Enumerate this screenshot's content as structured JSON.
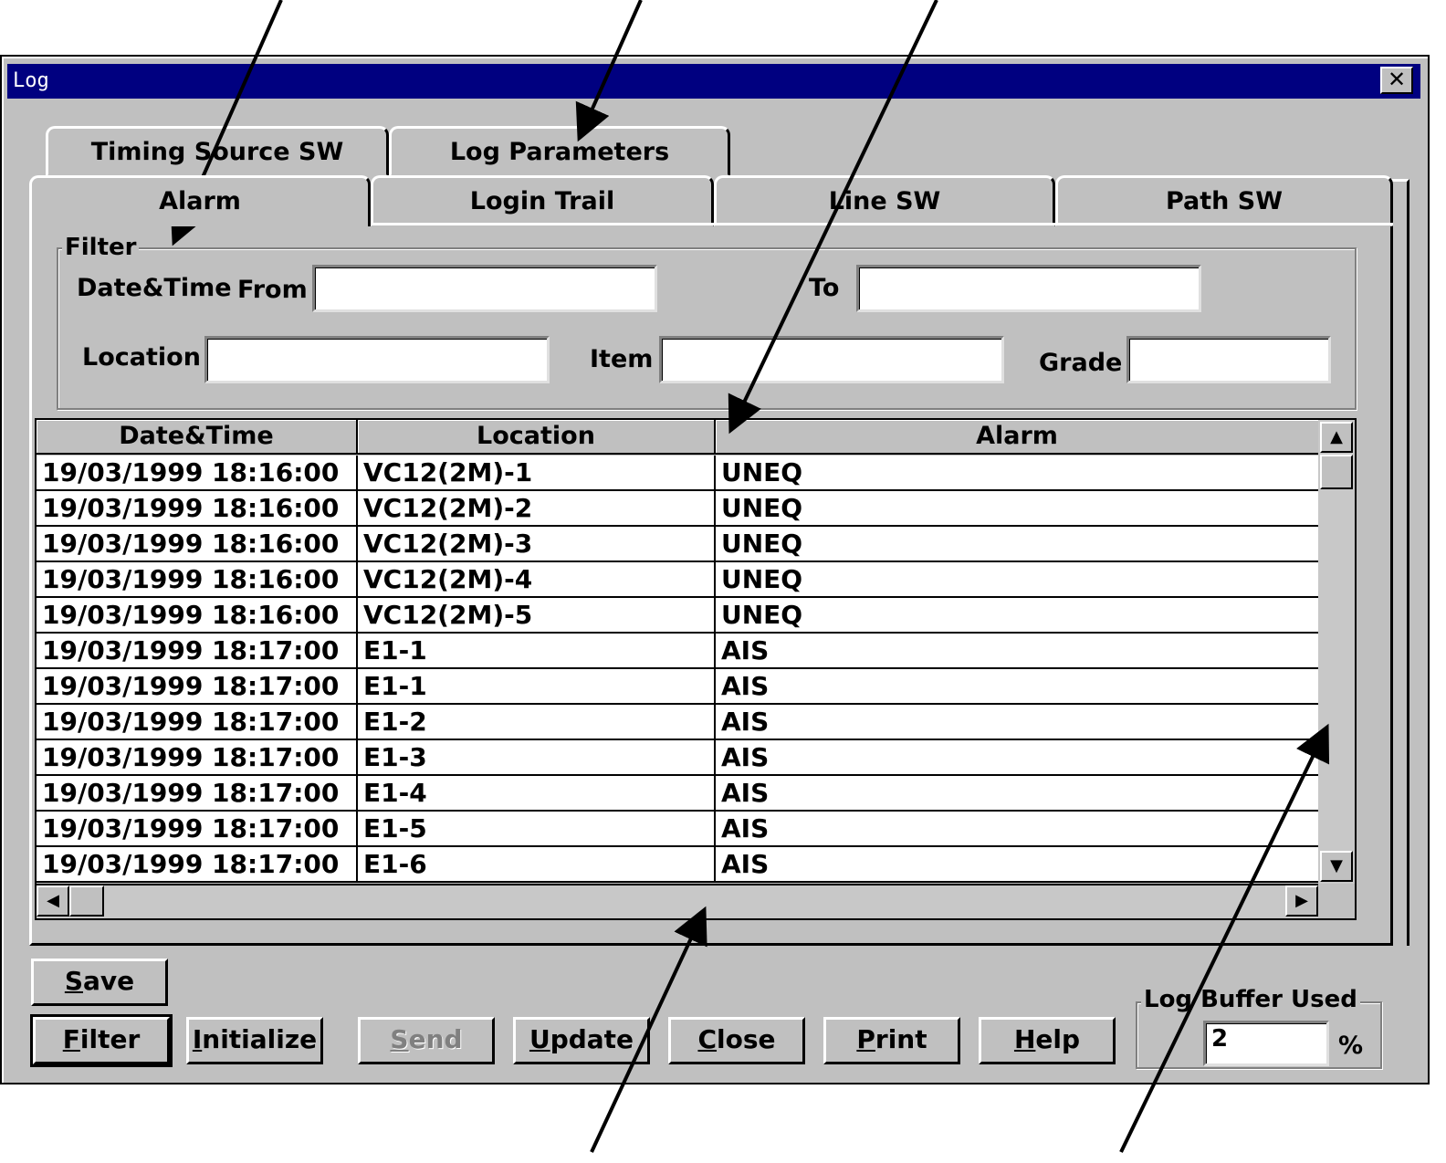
{
  "window": {
    "title": "Log",
    "close_glyph": "✕"
  },
  "tabs_back": [
    "Timing Source SW",
    "Log Parameters"
  ],
  "tabs_front": [
    "Alarm",
    "Login Trail",
    "Line SW",
    "Path SW"
  ],
  "active_tab": "Alarm",
  "filter": {
    "legend": "Filter",
    "datetime_label": "Date&Time",
    "from_label": "From",
    "from_value": "",
    "to_label": "To",
    "to_value": "",
    "location_label": "Location",
    "location_value": "",
    "item_label": "Item",
    "item_value": "",
    "grade_label": "Grade",
    "grade_value": ""
  },
  "table": {
    "columns": [
      "Date&Time",
      "Location",
      "Alarm"
    ],
    "rows": [
      [
        "19/03/1999 18:16:00",
        "VC12(2M)-1",
        "UNEQ"
      ],
      [
        "19/03/1999 18:16:00",
        "VC12(2M)-2",
        "UNEQ"
      ],
      [
        "19/03/1999 18:16:00",
        "VC12(2M)-3",
        "UNEQ"
      ],
      [
        "19/03/1999 18:16:00",
        "VC12(2M)-4",
        "UNEQ"
      ],
      [
        "19/03/1999 18:16:00",
        "VC12(2M)-5",
        "UNEQ"
      ],
      [
        "19/03/1999 18:17:00",
        "E1-1",
        "AIS"
      ],
      [
        "19/03/1999 18:17:00",
        "E1-1",
        "AIS"
      ],
      [
        "19/03/1999 18:17:00",
        "E1-2",
        "AIS"
      ],
      [
        "19/03/1999 18:17:00",
        "E1-3",
        "AIS"
      ],
      [
        "19/03/1999 18:17:00",
        "E1-4",
        "AIS"
      ],
      [
        "19/03/1999 18:17:00",
        "E1-5",
        "AIS"
      ],
      [
        "19/03/1999 18:17:00",
        "E1-6",
        "AIS"
      ]
    ]
  },
  "scroll_glyphs": {
    "up": "▲",
    "down": "▼",
    "left": "◀",
    "right": "▶"
  },
  "buttons": {
    "save": {
      "underline": "S",
      "rest": "ave"
    },
    "filter": {
      "underline": "F",
      "rest": "ilter"
    },
    "initialize": {
      "underline": "I",
      "rest": "nitialize"
    },
    "send": {
      "underline": "S",
      "rest": "end"
    },
    "update": {
      "underline": "U",
      "rest": "pdate"
    },
    "close": {
      "underline": "C",
      "rest": "lose"
    },
    "print": {
      "underline": "P",
      "rest": "rint"
    },
    "help": {
      "underline": "H",
      "rest": "elp"
    }
  },
  "log_buffer": {
    "label": "Log Buffer Used",
    "value": "2",
    "unit": "%"
  }
}
